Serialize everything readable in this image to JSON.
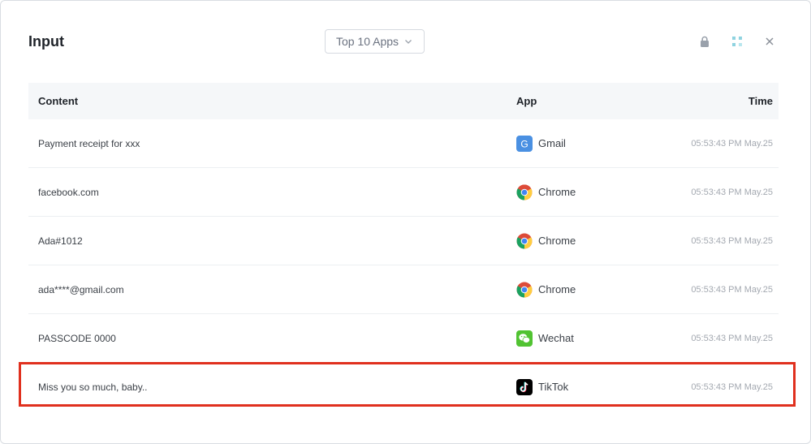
{
  "header": {
    "title": "Input",
    "filter_label": "Top 10 Apps"
  },
  "icons": {
    "lock": "lock-icon",
    "grid": "grid-icon",
    "close": "close-icon"
  },
  "table": {
    "columns": [
      "Content",
      "App",
      "Time"
    ],
    "rows": [
      {
        "content": "Payment receipt for xxx",
        "app": "Gmail",
        "app_icon": "gmail-icon",
        "time": "05:53:43 PM May.25"
      },
      {
        "content": "facebook.com",
        "app": "Chrome",
        "app_icon": "chrome-icon",
        "time": "05:53:43 PM May.25"
      },
      {
        "content": "Ada#1012",
        "app": "Chrome",
        "app_icon": "chrome-icon",
        "time": "05:53:43 PM May.25"
      },
      {
        "content": "ada****@gmail.com",
        "app": "Chrome",
        "app_icon": "chrome-icon",
        "time": "05:53:43 PM May.25"
      },
      {
        "content": "PASSCODE 0000",
        "app": "Wechat",
        "app_icon": "wechat-icon",
        "time": "05:53:43 PM May.25"
      },
      {
        "content": "Miss you so much, baby..",
        "app": "TikTok",
        "app_icon": "tiktok-icon",
        "time": "05:53:43 PM May.25"
      }
    ]
  },
  "colors": {
    "highlight": "#e0301e",
    "header_bg": "#f5f7f9",
    "gmail": "#4a90e2",
    "wechat": "#51c332",
    "tiktok": "#000000"
  }
}
